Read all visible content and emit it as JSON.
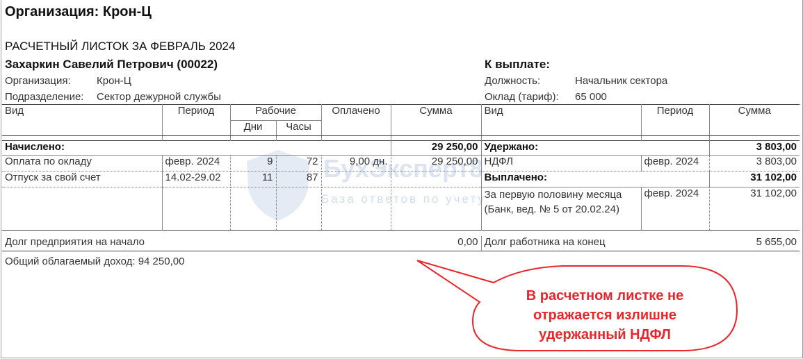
{
  "header": {
    "organization_title": "Организация: Крон-Ц",
    "document_title": "РАСЧЕТНЫЙ ЛИСТОК ЗА ФЕВРАЛЬ 2024",
    "employee": "Захаркин Савелий Петрович (00022)",
    "to_pay_label": "К выплате:",
    "org_label": "Организация:",
    "org_value": "Крон-Ц",
    "dept_label": "Подразделение:",
    "dept_value": "Сектор дежурной службы",
    "position_label": "Должность:",
    "position_value": "Начальник сектора",
    "salary_label": "Оклад (тариф):",
    "salary_value": "65 000"
  },
  "left_table": {
    "col_type": "Вид",
    "col_period": "Период",
    "col_work": "Рабочие",
    "col_days": "Дни",
    "col_hours": "Часы",
    "col_paid": "Оплачено",
    "col_sum": "Сумма",
    "accrued_label": "Начислено:",
    "accrued_total": "29 250,00",
    "rows": [
      {
        "type": "Оплата по окладу",
        "period": "февр. 2024",
        "days": "9",
        "hours": "72",
        "paid": "9,00 дн.",
        "sum": "29 250,00"
      },
      {
        "type": "Отпуск за свой счет",
        "period": "14.02-29.02",
        "days": "11",
        "hours": "87",
        "paid": "",
        "sum": ""
      }
    ],
    "debt_start_label": "Долг предприятия на начало",
    "debt_start_value": "0,00"
  },
  "right_table": {
    "col_type": "Вид",
    "col_period": "Период",
    "col_sum": "Сумма",
    "withheld_label": "Удержано:",
    "withheld_total": "3 803,00",
    "ndfl_label": "НДФЛ",
    "ndfl_period": "февр. 2024",
    "ndfl_sum": "3 803,00",
    "paid_label": "Выплачено:",
    "paid_total": "31 102,00",
    "paid_row_type": "За первую половину месяца (Банк, вед. № 5 от 20.02.24)",
    "paid_row_period": "февр. 2024",
    "paid_row_sum": "31 102,00",
    "debt_end_label": "Долг работника на конец",
    "debt_end_value": "5 655,00"
  },
  "footer": {
    "taxable_income": "Общий облагаемый доход: 94 250,00"
  },
  "watermark": {
    "title": "БухЭксперт8",
    "subtitle": "База ответов по учету"
  },
  "callout": {
    "text": "В расчетном листке не отражается излишне удержанный НДФЛ",
    "color": "#e8262c"
  }
}
